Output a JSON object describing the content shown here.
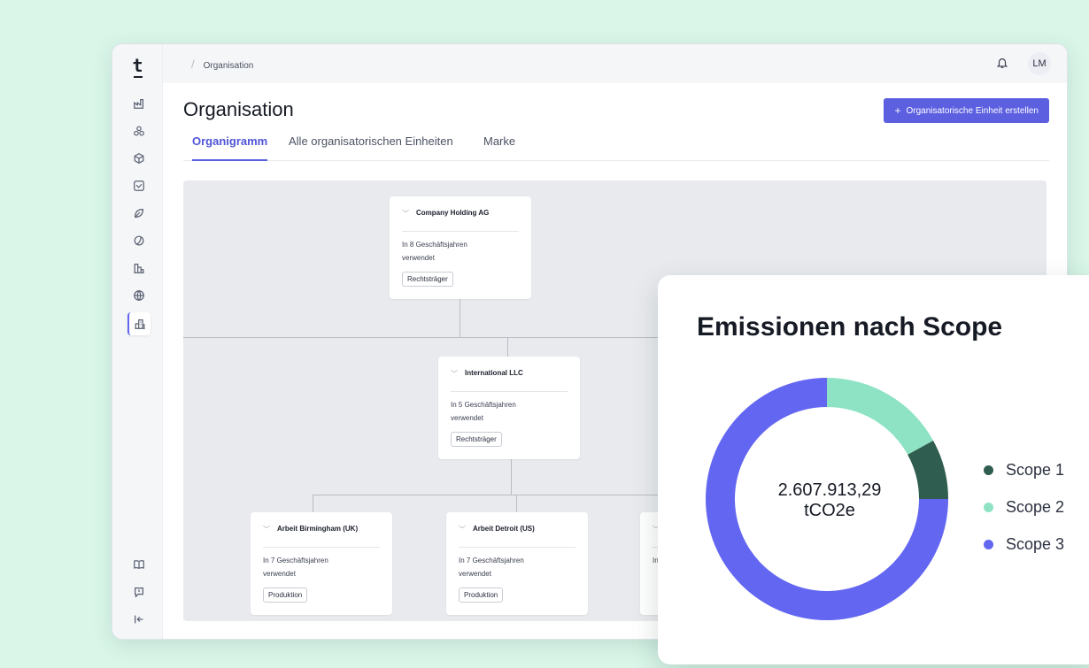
{
  "topbar": {
    "breadcrumb": "Organisation",
    "avatar_initials": "LM"
  },
  "page": {
    "title": "Organisation",
    "create_button": "Organisatorische Einheit erstellen"
  },
  "tabs": [
    {
      "label": "Organigramm",
      "active": true
    },
    {
      "label": "Alle organisatorischen Einheiten",
      "active": false
    },
    {
      "label": "Marke",
      "active": false
    }
  ],
  "sidebar": {
    "icons": [
      "factory-icon",
      "network-icon",
      "cube-icon",
      "chart-box-icon",
      "leaf-icon",
      "globe-ring-icon",
      "buildings-icon",
      "globe-icon",
      "organisation-icon"
    ],
    "bottom_icons": [
      "book-icon",
      "feedback-icon",
      "collapse-icon"
    ]
  },
  "org": {
    "nodes": [
      {
        "name": "Company Holding AG",
        "desc": "In 8 Geschäftsjahren verwendet",
        "tag": "Rechtsträger"
      },
      {
        "name": "International LLC",
        "desc": "In 5 Geschäftsjahren verwendet",
        "tag": "Rechtsträger"
      },
      {
        "name": "Arbeit Birmingham (UK)",
        "desc": "In 7 Geschäftsjahren verwendet",
        "tag": "Produktion"
      },
      {
        "name": "Arbeit Detroit (US)",
        "desc": "In 7 Geschäftsjahren verwendet",
        "tag": "Produktion"
      },
      {
        "name": "",
        "desc": "In",
        "tag": ""
      }
    ]
  },
  "emissions": {
    "title": "Emissionen nach Scope",
    "total_value": "2.607.913,29",
    "total_unit": "tCO2e",
    "legend": [
      {
        "label": "Scope 1",
        "color": "#2f5d4f"
      },
      {
        "label": "Scope 2",
        "color": "#8ee3c4"
      },
      {
        "label": "Scope 3",
        "color": "#6366f1"
      }
    ]
  },
  "chart_data": {
    "type": "pie",
    "title": "Emissionen nach Scope",
    "categories": [
      "Scope 1",
      "Scope 2",
      "Scope 3"
    ],
    "values": [
      8,
      17,
      75
    ],
    "colors": [
      "#2f5d4f",
      "#8ee3c4",
      "#6366f1"
    ],
    "center_label": "2.607.913,29 tCO2e",
    "legend": "right"
  }
}
